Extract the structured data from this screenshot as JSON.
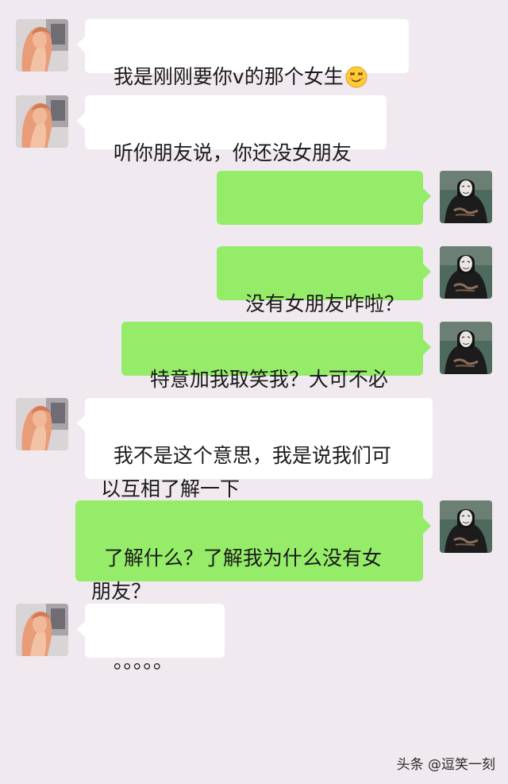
{
  "messages": [
    {
      "sender": "other",
      "text": "我是刚刚要你v的那个女生",
      "emoji": "smirk-emoji"
    },
    {
      "sender": "other",
      "text": "听你朋友说，你还没女朋友"
    },
    {
      "sender": "me",
      "text": "？？？？？？？？？"
    },
    {
      "sender": "me",
      "text": "没有女朋友咋啦？"
    },
    {
      "sender": "me",
      "text": "特意加我取笑我？大可不必"
    },
    {
      "sender": "other",
      "text": "我不是这个意思，我是说我们可\n以互相了解一下"
    },
    {
      "sender": "me",
      "text": "了解什么？了解我为什么没有女\n朋友？"
    },
    {
      "sender": "other",
      "text": "。。。。。"
    }
  ],
  "watermark": "头条 @逗笑一刻",
  "colors": {
    "background": "#f0eaf0",
    "other_bubble": "#ffffff",
    "my_bubble": "#95ec69"
  },
  "icons": {
    "other_avatar": "girl-avatar",
    "my_avatar": "masked-man-avatar"
  }
}
